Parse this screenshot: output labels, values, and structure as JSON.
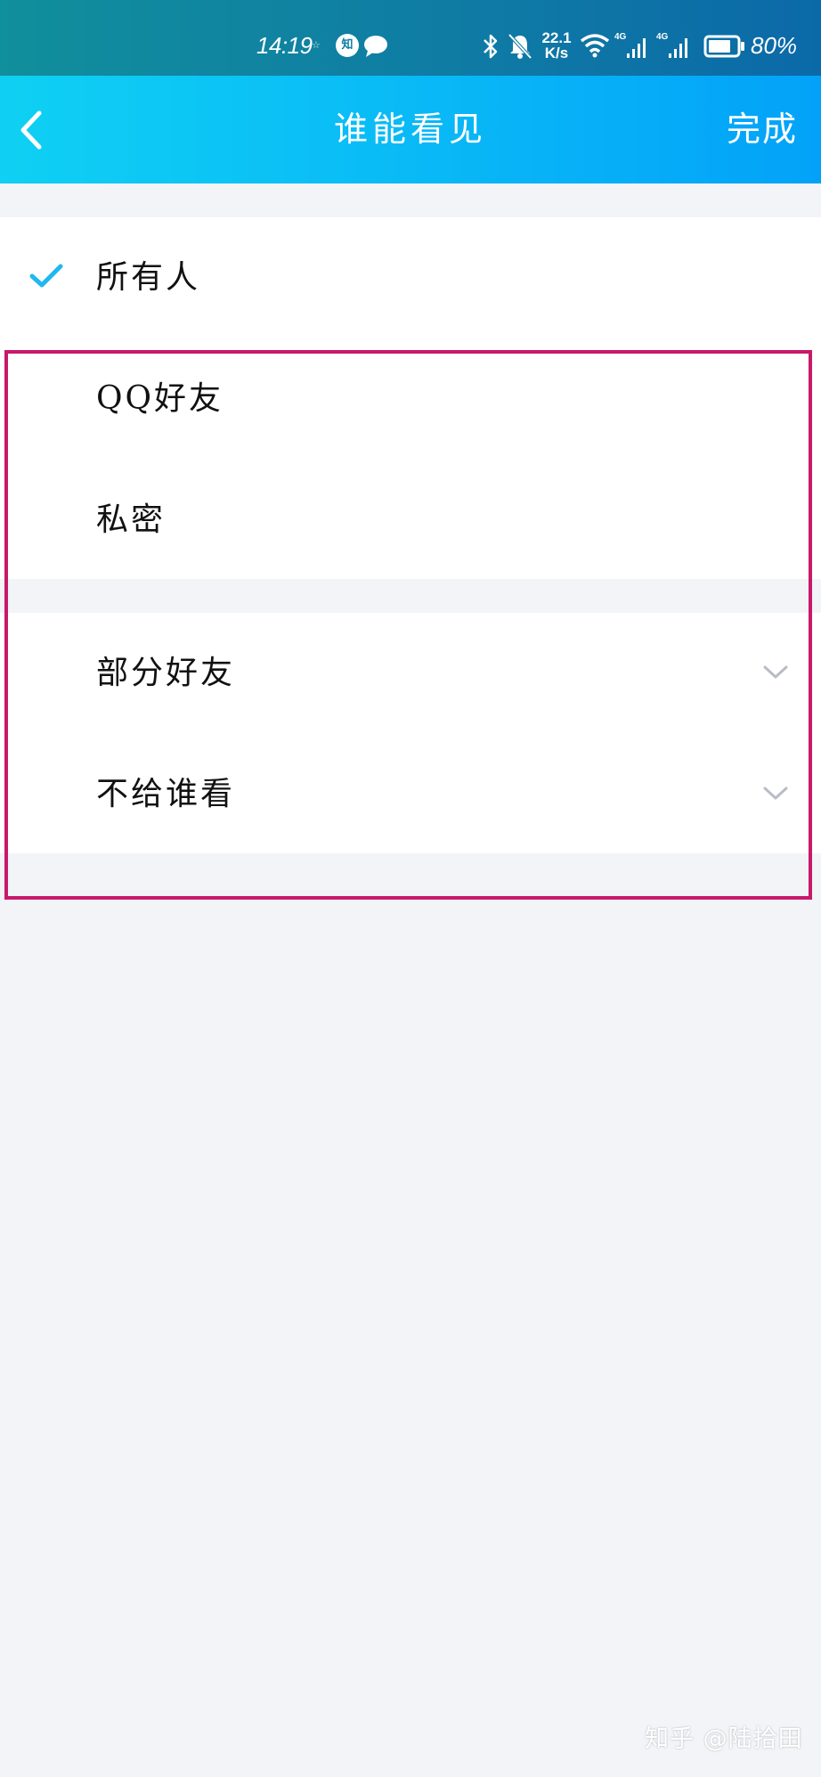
{
  "status_bar": {
    "time": "14:19",
    "notif_app": "知",
    "speed_top": "22.1",
    "speed_bottom": "K/s",
    "net1": "4G",
    "net2": "4G",
    "battery": "80%",
    "battery_level": 0.8
  },
  "nav": {
    "back_icon": "chevron-left-icon",
    "title": "谁能看见",
    "done": "完成"
  },
  "options": {
    "everyone": "所有人",
    "qq_friends": "QQ好友",
    "private": "私密",
    "some_friends": "部分好友",
    "hide_from": "不给谁看"
  },
  "selected": "所有人",
  "colors": {
    "accent": "#1fb8f0",
    "nav_start": "#0fd0f3",
    "nav_end": "#03a2f8",
    "highlight": "#c8196a",
    "background": "#f3f4f8"
  },
  "watermark": "知乎 @陆拾田"
}
